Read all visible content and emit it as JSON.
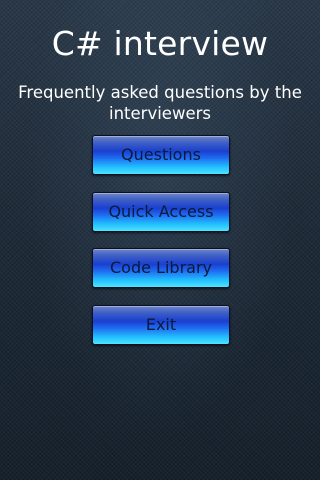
{
  "header": {
    "title": "C# interview",
    "subtitle": "Frequently asked questions by the interviewers"
  },
  "menu": {
    "buttons": [
      {
        "label": "Questions"
      },
      {
        "label": "Quick Access"
      },
      {
        "label": "Code Library"
      },
      {
        "label": "Exit"
      }
    ]
  },
  "colors": {
    "button_top": "#3e5fc6",
    "button_bottom": "#4fe3ff",
    "button_text": "#0a1a3a",
    "background": "#1e2b38"
  }
}
